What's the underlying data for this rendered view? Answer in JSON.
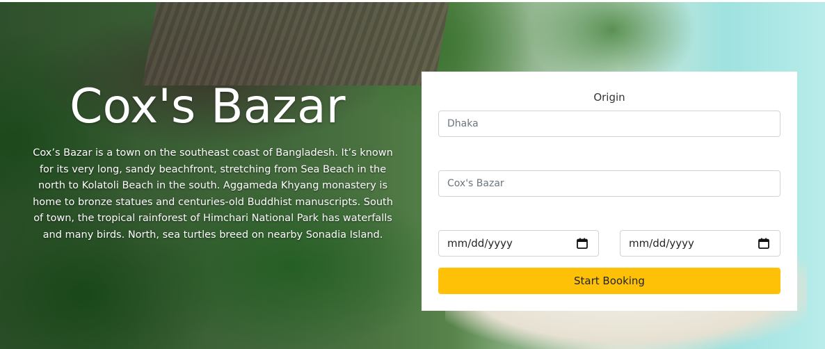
{
  "hero": {
    "title": "Cox's Bazar",
    "description": "Cox’s Bazar is a town on the southeast coast of Bangladesh. It’s known for its very long, sandy beachfront, stretching from Sea Beach in the north to Kolatoli Beach in the south. Aggameda Khyang monastery is home to bronze statues and centuries-old Buddhist manuscripts. South of town, the tropical rainforest of Himchari National Park has waterfalls and many birds. North, sea turtles breed on nearby Sonadia Island."
  },
  "booking": {
    "origin_label": "Origin",
    "origin_value": "Dhaka",
    "destination_value": "Cox's Bazar",
    "start_date_placeholder": "mm/dd/yyyy",
    "end_date_placeholder": "mm/dd/yyyy",
    "calendar_icon": "calendar-icon",
    "submit_label": "Start Booking",
    "submit_color": "#ffc107"
  }
}
